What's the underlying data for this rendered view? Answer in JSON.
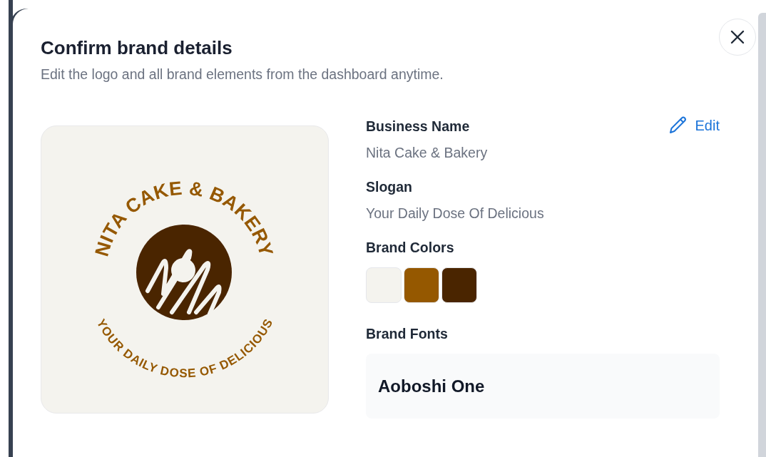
{
  "dialog": {
    "title": "Confirm brand details",
    "subtitle": "Edit the logo and all brand elements from the dashboard anytime."
  },
  "logo": {
    "name": "NITA CAKE & BAKERY",
    "slogan": "YOUR DAILY DOSE OF DELICIOUS"
  },
  "edit_button": {
    "label": "Edit"
  },
  "fields": [
    {
      "label": "Business Name",
      "value": "Nita Cake & Bakery"
    },
    {
      "label": "Slogan",
      "value": "Your Daily Dose Of Delicious"
    }
  ],
  "brand_colors": {
    "label": "Brand Colors",
    "colors": [
      {
        "color": "#f4f3ee"
      },
      {
        "color": "#955800"
      },
      {
        "color": "#4a2500"
      }
    ]
  },
  "brand_fonts": {
    "label": "Brand Fonts",
    "fonts": [
      "Aoboshi One"
    ]
  }
}
